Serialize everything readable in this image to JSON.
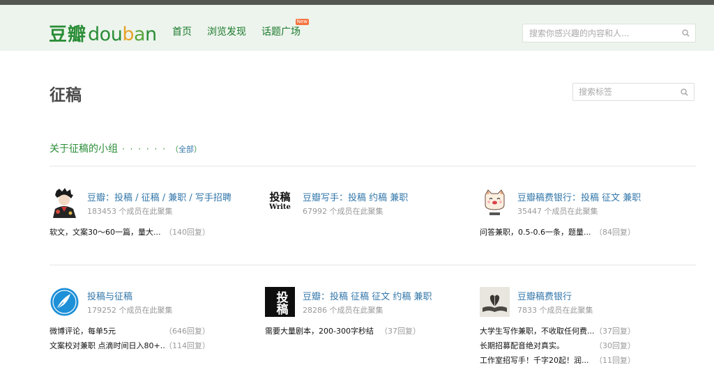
{
  "header": {
    "logo_cn": "豆瓣",
    "logo_en": [
      "d",
      "o",
      "u",
      "b",
      "a",
      "n"
    ],
    "nav": [
      {
        "label": "首页"
      },
      {
        "label": "浏览发现"
      },
      {
        "label": "话题广场",
        "badge": "New"
      }
    ],
    "search_placeholder": "搜索你感兴趣的内容和人..."
  },
  "page": {
    "title": "征稿",
    "tag_search_placeholder": "搜索标签",
    "section_title": "关于征稿的小组",
    "section_dots": "· · · · · ·",
    "all_open": "（",
    "all_label": "全部",
    "all_close": "）"
  },
  "groups": [
    {
      "name": "豆瓣：投稿 / 征稿 / 兼职 / 写手招聘",
      "members": "183453 个成员在此聚集",
      "avatar": "boy-portrait-icon",
      "topics": [
        {
          "title": "软文，文案30～60一篇，量大...",
          "replies": "（140回复）"
        }
      ]
    },
    {
      "name": "豆瓣写手：投稿 约稿 兼职",
      "members": "67992 个成员在此聚集",
      "avatar": "write-text-logo",
      "avatar_text_cn": "投稿",
      "avatar_text_en": "Write",
      "topics": []
    },
    {
      "name": "豆瓣稿费银行：投稿 征文 兼职",
      "members": "35447 个成员在此聚集",
      "avatar": "cat-face-icon",
      "topics": [
        {
          "title": "问答兼职，0.5-0.6一条，题量...",
          "replies": "（84回复）"
        }
      ]
    },
    {
      "name": "投稿与征稿",
      "members": "179252 个成员在此聚集",
      "avatar": "pen-nib-circle-icon",
      "topics": [
        {
          "title": "微博评论，每单5元",
          "replies": "（646回复）"
        },
        {
          "title": "文案校对兼职 点滴时间日入80+...",
          "replies": "（114回复）"
        }
      ]
    },
    {
      "name": "豆瓣：投稿 征稿 征文 约稿 兼职",
      "members": "28286 个成员在此聚集",
      "avatar": "calligraphy-logo",
      "avatar_text_cn": "投稿",
      "topics": [
        {
          "title": "需要大量剧本，200-300字秒结",
          "replies": "（37回复）"
        }
      ]
    },
    {
      "name": "豆瓣稿费银行",
      "members": "7833 个成员在此聚集",
      "avatar": "open-book-heart-icon",
      "topics": [
        {
          "title": "大学生写作兼职，不收取任何费...",
          "replies": "（37回复）"
        },
        {
          "title": "长期招募配音绝对真实。",
          "replies": "（30回复）"
        },
        {
          "title": "工作室招写手！千字20起！润...",
          "replies": "（11回复）"
        }
      ]
    }
  ],
  "colors": {
    "brand_green": "#2a8d37",
    "link_blue": "#37a",
    "nav_bg": "#edf4ed",
    "topbar": "#545652"
  }
}
